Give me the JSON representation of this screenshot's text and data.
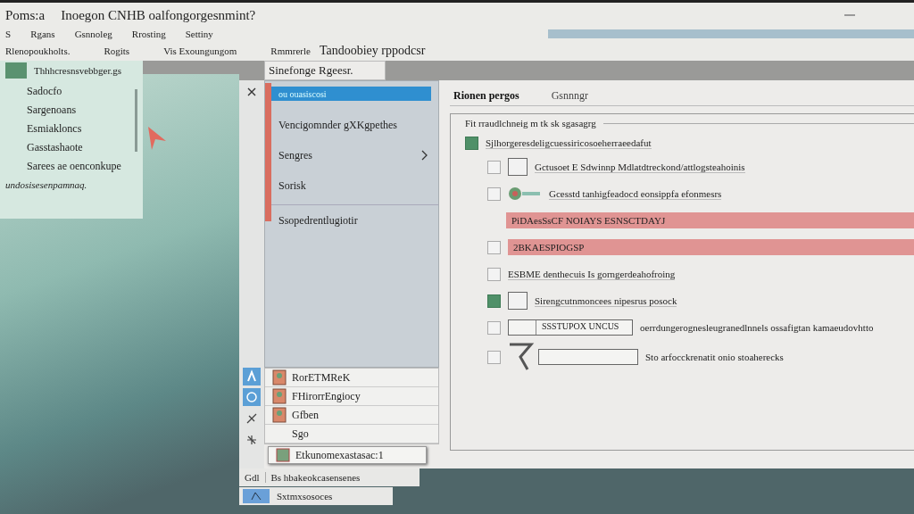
{
  "window": {
    "title": "Poms:a",
    "subtitle": "Inoegon CNHB oalfongorgesnmint?"
  },
  "menu": [
    "S",
    "Rgans",
    "Gsnnoleg",
    "Rrosting",
    "Settiny"
  ],
  "toolbar": [
    {
      "label": "Rlenopoukholts.",
      "kind": "small"
    },
    {
      "label": "Rogits",
      "kind": "small"
    },
    {
      "label": "Vis Exoungungom",
      "kind": "small"
    },
    {
      "label": "Rmmrerle",
      "kind": "small"
    },
    {
      "label": "Tandoobiey rppodcsr",
      "kind": "large"
    }
  ],
  "left_panel": {
    "header": "Thhhcresnsvebbger.gs",
    "items": [
      "Sadocfo",
      "Sargenoans",
      "Esmiakloncs",
      "Gasstashaote",
      "Sarees ae oenconkupe"
    ],
    "footer": "undosisesenpamnaq."
  },
  "dialog": {
    "tab": "Sinefonge Rgeesr.",
    "nav": [
      {
        "label": "ou ouasiscosi",
        "selected": true,
        "has_submenu": false
      },
      {
        "label": "Vencigomnder gXKgpethes",
        "selected": false,
        "has_submenu": false
      },
      {
        "label": "Sengres",
        "selected": false,
        "has_submenu": true
      },
      {
        "label": "Sorisk",
        "selected": false,
        "has_submenu": false
      },
      {
        "label": "Ssopedrentlugiotir",
        "selected": false,
        "has_submenu": false
      }
    ],
    "files": [
      {
        "label": "RorETMReK",
        "kind": "icon"
      },
      {
        "label": "FHirorrEngiocy",
        "kind": "icon"
      },
      {
        "label": "Gfben",
        "kind": "icon"
      },
      {
        "label": "Sgo",
        "kind": "plain"
      }
    ],
    "popup": "Etkunomexastasac:1",
    "tabs": [
      {
        "label": "Rionen pergos",
        "selected": true
      },
      {
        "label": "Gsnnngr",
        "selected": false
      }
    ],
    "group": {
      "title": "Fit rraudlchneig m tk sk sgasagrg",
      "rows": [
        {
          "kind": "check",
          "checked": true,
          "label": "Sjlhorgeresdeligcuessiricosoeherraeedafut"
        },
        {
          "kind": "check-box",
          "checked": false,
          "label": "Gctusoet E Sdwinnp Mdlatdtreckond/attlogsteahoinis"
        },
        {
          "kind": "check-icon",
          "checked": false,
          "label": "Gcesstd tanhigfeadocd eonsippfa efonmesrs"
        },
        {
          "kind": "alert",
          "label": "PiDAesSsCF NOIAYS ESNSCTDAYJ"
        },
        {
          "kind": "check-alert",
          "checked": false,
          "label": "2BKAESPIOGSP"
        },
        {
          "kind": "check",
          "checked": false,
          "label": "ESBME denthecuis Is gorngerdeahofroing"
        },
        {
          "kind": "check-box",
          "checked": true,
          "label": "Sirengcutnmoncees nipesrus posock"
        },
        {
          "kind": "check-field",
          "checked": false,
          "value": "SSSTUPOX UNCUS",
          "label": "oerrdungerognesleugranedlnnels ossafigtan kamaeudovhtto"
        },
        {
          "kind": "check-arrow-field",
          "checked": false,
          "label": "Sto arfocckrenatit onio stoaherecks"
        }
      ]
    }
  },
  "status": [
    {
      "label": "Gdl"
    },
    {
      "label": "Bs hbakeokcasensenes"
    }
  ],
  "taskbar": {
    "label": "Sxtmxsosoces"
  }
}
